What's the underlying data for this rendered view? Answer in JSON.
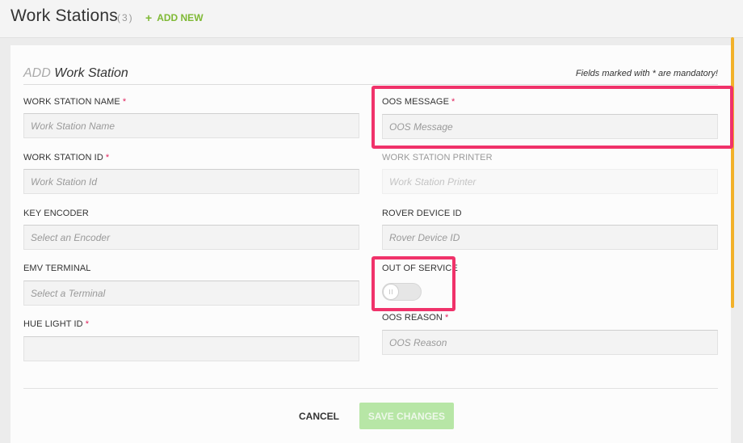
{
  "header": {
    "title": "Work Stations",
    "count": "(3)",
    "add_new_icon": "plus-icon",
    "add_new_label": "ADD NEW"
  },
  "form": {
    "heading_prefix": "ADD",
    "heading_main": "Work Station",
    "mandatory_note": "Fields marked with * are mandatory!",
    "required_mark": "*",
    "fields": {
      "work_station_name": {
        "label": "WORK STATION NAME",
        "placeholder": "Work Station Name"
      },
      "work_station_id": {
        "label": "WORK STATION ID",
        "placeholder": "Work Station Id"
      },
      "key_encoder": {
        "label": "KEY ENCODER",
        "placeholder": "Select an Encoder"
      },
      "emv_terminal": {
        "label": "EMV TERMINAL",
        "placeholder": "Select a Terminal"
      },
      "hue_light_id": {
        "label": "HUE LIGHT ID",
        "placeholder": ""
      },
      "oos_message": {
        "label": "OOS MESSAGE",
        "placeholder": "OOS Message"
      },
      "work_station_printer": {
        "label": "WORK STATION PRINTER",
        "placeholder": "Work Station Printer"
      },
      "rover_device_id": {
        "label": "ROVER DEVICE ID",
        "placeholder": "Rover Device ID"
      },
      "out_of_service": {
        "label": "OUT OF SERVICE",
        "value": "off"
      },
      "oos_reason": {
        "label": "OOS REASON",
        "placeholder": "OOS Reason"
      }
    },
    "actions": {
      "cancel_label": "CANCEL",
      "save_label": "SAVE CHANGES"
    }
  },
  "colors": {
    "accent_green": "#7fb935",
    "required_red": "#e0245e",
    "highlight_pink": "#f0326a",
    "scroll_orange": "#f2b12a",
    "save_disabled_green": "#b7e6a6"
  }
}
